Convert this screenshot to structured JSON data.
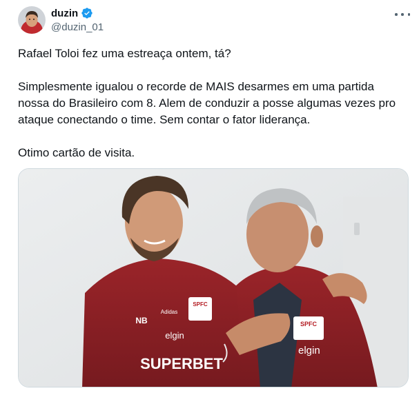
{
  "author": {
    "display_name": "duzin",
    "handle": "@duzin_01",
    "verified_icon": "verified-badge-icon"
  },
  "tweet": {
    "paragraphs": [
      "Rafael Toloi fez uma estreaça ontem, tá?",
      "Simplesmente igualou o recorde de MAIS desarmes em uma partida nossa do Brasileiro com 8. Alem de conduzir a posse algumas vezes pro ataque conectando o time. Sem contar o fator liderança.",
      "Otimo cartão de visita."
    ]
  },
  "media": {
    "jersey_left": [
      "SUPERBET",
      "Adidas",
      "SPFC",
      "elgin",
      "NB"
    ],
    "jersey_right": [
      "SPFC",
      "elgin"
    ]
  },
  "colors": {
    "text": "#0f1419",
    "secondary": "#536471",
    "verified": "#1d9bf0",
    "border": "#cfd9de",
    "jersey": "#8c1f24"
  }
}
